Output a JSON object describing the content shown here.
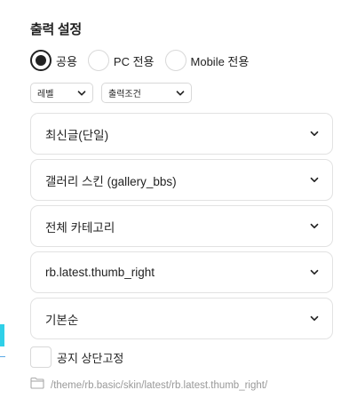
{
  "section_title": "출력 설정",
  "output_target": {
    "options": [
      {
        "label": "공용",
        "checked": true
      },
      {
        "label": "PC 전용",
        "checked": false
      },
      {
        "label": "Mobile 전용",
        "checked": false
      }
    ]
  },
  "filters": {
    "level": "레벨",
    "condition": "출력조건"
  },
  "selects": {
    "sort_source": "최신글(단일)",
    "skin": "갤러리 스킨 (gallery_bbs)",
    "category": "전체 카테고리",
    "layout": "rb.latest.thumb_right",
    "order": "기본순"
  },
  "notice_pin": {
    "label": "공지 상단고정",
    "checked": false
  },
  "skin_path": "/theme/rb.basic/skin/latest/rb.latest.thumb_right/",
  "colors": {
    "accent": "#2fd0e8",
    "text": "#222222",
    "border": "#e2e2e2",
    "muted": "#999999"
  }
}
